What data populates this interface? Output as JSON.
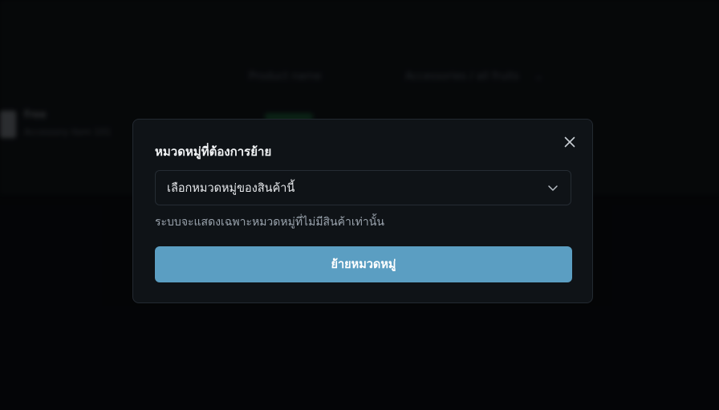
{
  "background": {
    "header": {
      "col_name": "Product name",
      "col_category": "Accessories / all fruits"
    },
    "row": {
      "name": "Free",
      "sub": "Accessory item 101"
    }
  },
  "modal": {
    "title": "หมวดหมู่ที่ต้องการย้าย",
    "select": {
      "placeholder": "เลือกหมวดหมู่ของสินค้านี้"
    },
    "helper_text": "ระบบจะแสดงเฉพาะหมวดหมู่ที่ไม่มีสินค้าเท่านั้น",
    "submit_label": "ย้ายหมวดหมู่",
    "icons": {
      "close": "close-icon",
      "dropdown": "chevron-down-icon"
    }
  },
  "colors": {
    "accent": "#5b9ec2",
    "modal_bg": "#0f1317",
    "page_bg": "#080a0c"
  }
}
